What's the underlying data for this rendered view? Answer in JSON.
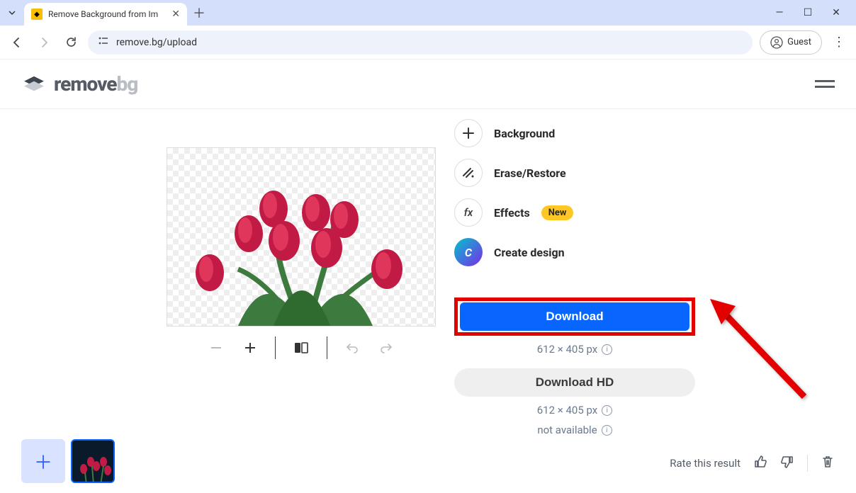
{
  "browser": {
    "tab_title": "Remove Background from Im",
    "url": "remove.bg/upload",
    "guest_label": "Guest"
  },
  "logo": {
    "remove": "remove",
    "bg": "bg"
  },
  "actions": {
    "background": "Background",
    "erase_restore": "Erase/Restore",
    "effects": "Effects",
    "effects_badge": "New",
    "create_design": "Create design"
  },
  "download": {
    "primary_label": "Download",
    "primary_dims": "612 × 405 px",
    "hd_label": "Download HD",
    "hd_dims": "612 × 405 px",
    "hd_unavailable": "not available"
  },
  "rate": {
    "label": "Rate this result"
  }
}
